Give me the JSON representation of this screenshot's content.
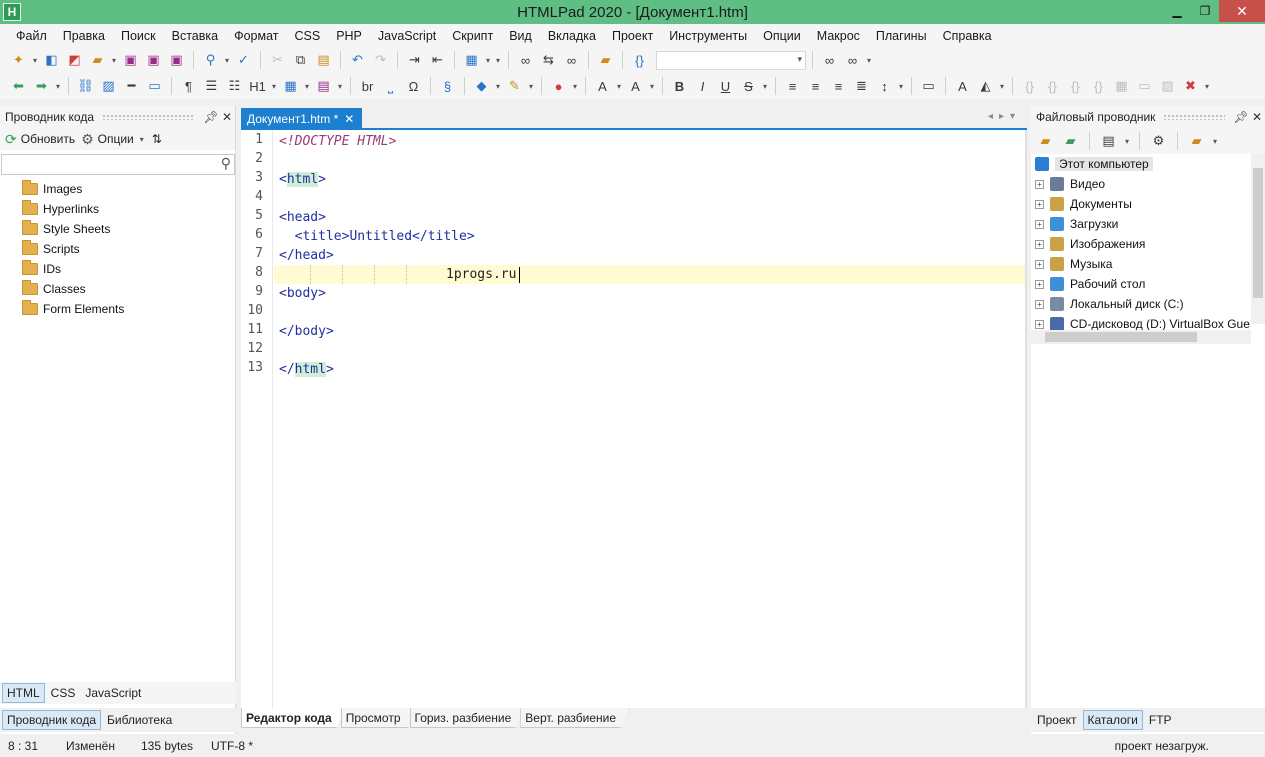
{
  "window": {
    "title": "HTMLPad 2020 - [Документ1.htm]",
    "app_icon_letter": "H",
    "minimize": "▁",
    "maximize": "❐",
    "close": "✕"
  },
  "menu": [
    "Файл",
    "Правка",
    "Поиск",
    "Вставка",
    "Формат",
    "CSS",
    "PHP",
    "JavaScript",
    "Скрипт",
    "Вид",
    "Вкладка",
    "Проект",
    "Инструменты",
    "Опции",
    "Макрос",
    "Плагины",
    "Справка"
  ],
  "toolbar2_labels": {
    "heading": "H1",
    "br": "br",
    "omega": "Ω"
  },
  "left_panel": {
    "title": "Проводник кода",
    "refresh_label": "Обновить",
    "options_label": "Опции",
    "search_placeholder": "",
    "items": [
      "Images",
      "Hyperlinks",
      "Style Sheets",
      "Scripts",
      "IDs",
      "Classes",
      "Form Elements"
    ],
    "lang_tabs": [
      "HTML",
      "CSS",
      "JavaScript"
    ],
    "active_lang_tab": "HTML",
    "bottom_tabs": [
      "Проводник кода",
      "Библиотека"
    ]
  },
  "editor": {
    "tab_label": "Документ1.htm *",
    "line_numbers": [
      "1",
      "2",
      "3",
      "4",
      "5",
      "6",
      "7",
      "8",
      "9",
      "10",
      "11",
      "12",
      "13"
    ],
    "lines": {
      "l1": "<!DOCTYPE HTML>",
      "l3_open": "<",
      "l3_tag": "html",
      "l3_close": ">",
      "l5": "<head>",
      "l6": "  <title>Untitled</title>",
      "l7": "</head>",
      "l8": "1progs.ru",
      "l9": "<body>",
      "l11": "</body>",
      "l13_open": "</",
      "l13_tag": "html",
      "l13_close": ">"
    },
    "view_tabs": [
      "Редактор кода",
      "Просмотр",
      "Гориз. разбиение",
      "Верт. разбиение"
    ],
    "active_view_tab": "Редактор кода"
  },
  "right_panel": {
    "title": "Файловый проводник",
    "root": "Этот компьютер",
    "items": [
      "Видео",
      "Документы",
      "Загрузки",
      "Изображения",
      "Музыка",
      "Рабочий стол",
      "Локальный диск (C:)",
      "CD-дисковод (D:) VirtualBox Gue"
    ],
    "item_colors": [
      "#6a7c98",
      "#c9a247",
      "#3c8fd8",
      "#c9a247",
      "#c9a247",
      "#3c8fd8",
      "#7a8aa0",
      "#4a6aa8"
    ],
    "bottom_tabs": [
      "Проект",
      "Каталоги",
      "FTP"
    ],
    "active_bottom_tab": "Каталоги"
  },
  "status": {
    "position": "8 : 31",
    "modified": "Изменён",
    "size": "135 bytes",
    "encoding": "UTF-8 *",
    "project": "проект незагруж."
  },
  "colors": {
    "titlebar": "#5fbe83",
    "tab_active": "#1c7fd0",
    "current_line": "#fffbd2",
    "tag_color": "#1f2fa0"
  }
}
